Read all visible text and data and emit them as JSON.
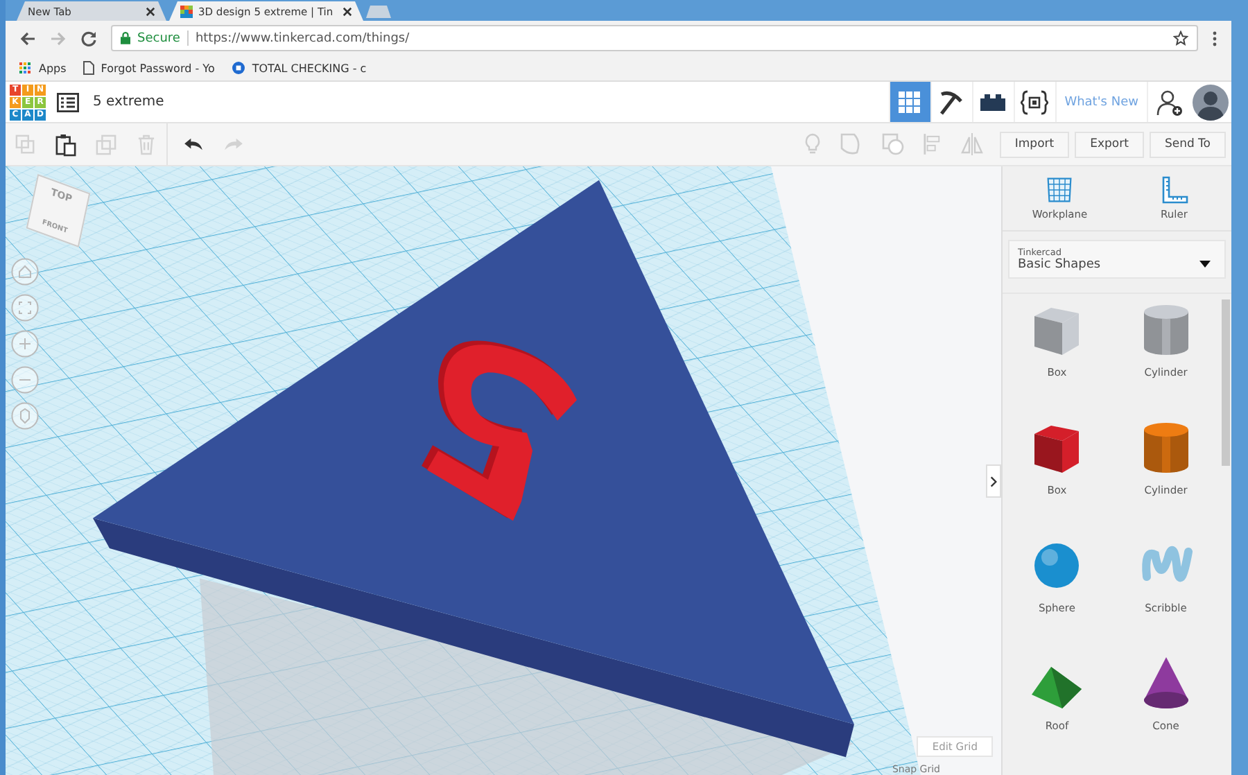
{
  "browser": {
    "tabs": [
      {
        "title": "New Tab",
        "selected": false
      },
      {
        "title": "3D design 5 extreme | Tin",
        "selected": true
      }
    ],
    "secure_label": "Secure",
    "url": "https://www.tinkercad.com/things/",
    "bookmarks": [
      {
        "kind": "apps",
        "label": "Apps"
      },
      {
        "kind": "page",
        "label": "Forgot Password - Yo"
      },
      {
        "kind": "bank",
        "label": "TOTAL CHECKING - c"
      }
    ]
  },
  "header": {
    "logo_letters": [
      "T",
      "I",
      "N",
      "K",
      "E",
      "R",
      "C",
      "A",
      "D"
    ],
    "design_name": "5 extreme",
    "views": [
      {
        "kind": "grid",
        "selected": true
      },
      {
        "kind": "pickaxe",
        "selected": false
      },
      {
        "kind": "brick",
        "selected": false
      },
      {
        "kind": "code",
        "selected": false
      }
    ],
    "whats_new": "What's New"
  },
  "toolbar": {
    "actions": [
      {
        "kind": "copy",
        "disabled": true
      },
      {
        "kind": "paste",
        "disabled": false
      },
      {
        "kind": "duplicate",
        "disabled": true
      },
      {
        "kind": "delete",
        "disabled": true
      },
      {
        "kind": "undo",
        "disabled": false
      },
      {
        "kind": "redo",
        "disabled": true
      }
    ],
    "buttons": [
      "Import",
      "Export",
      "Send To"
    ]
  },
  "viewport": {
    "cube_top": "TOP",
    "cube_front": "FRONT",
    "edit_grid": "Edit Grid",
    "snap_grid": "Snap Grid"
  },
  "panel": {
    "tools": [
      {
        "kind": "workplane",
        "label": "Workplane"
      },
      {
        "kind": "ruler",
        "label": "Ruler"
      }
    ],
    "library_source": "Tinkercad",
    "library": "Basic Shapes",
    "shapes": [
      {
        "kind": "box",
        "label": "Box",
        "color": "#c8ccd2"
      },
      {
        "kind": "cylinder",
        "label": "Cylinder",
        "color": "#c8ccd2"
      },
      {
        "kind": "box",
        "label": "Box",
        "color": "#d41f2a"
      },
      {
        "kind": "cylinder",
        "label": "Cylinder",
        "color": "#ee7c12"
      },
      {
        "kind": "sphere",
        "label": "Sphere",
        "color": "#1a8fcf"
      },
      {
        "kind": "scribble",
        "label": "Scribble",
        "color": "#8fc3e0"
      },
      {
        "kind": "roof",
        "label": "Roof",
        "color": "#2e9e3a"
      },
      {
        "kind": "cone",
        "label": "Cone",
        "color": "#8e3a9e"
      }
    ]
  }
}
